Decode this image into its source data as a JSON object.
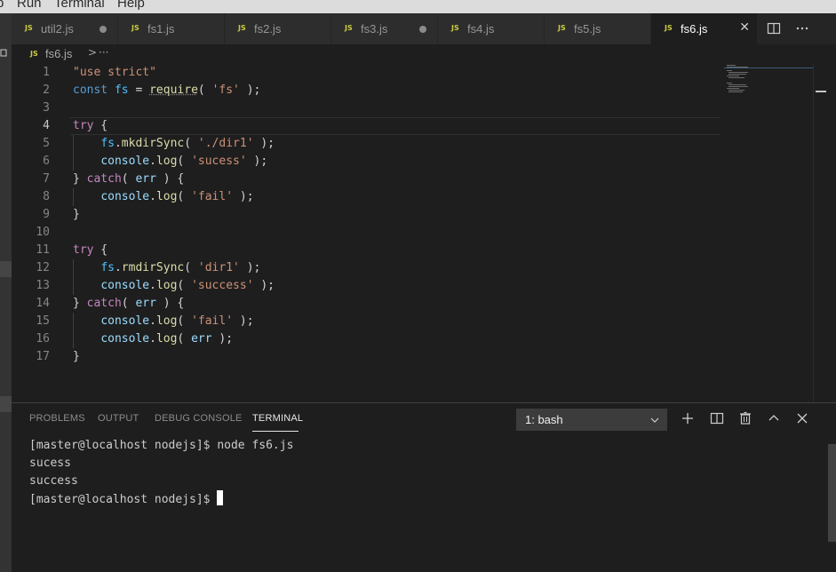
{
  "menubar": {
    "items": [
      "b",
      "Run",
      "Terminal",
      "Help"
    ]
  },
  "tabs": [
    {
      "label": "util2.js",
      "modified": true,
      "active": false
    },
    {
      "label": "fs1.js",
      "modified": false,
      "active": false
    },
    {
      "label": "fs2.js",
      "modified": false,
      "active": false
    },
    {
      "label": "fs3.js",
      "modified": true,
      "active": false
    },
    {
      "label": "fs4.js",
      "modified": false,
      "active": false
    },
    {
      "label": "fs5.js",
      "modified": false,
      "active": false
    },
    {
      "label": "fs6.js",
      "modified": false,
      "active": true
    }
  ],
  "tab_badge": "JS",
  "tab_close_glyph": "✕",
  "editor_actions": [
    "split-editor-icon",
    "more-actions-icon"
  ],
  "breadcrumb": {
    "badge": "JS",
    "file": "fs6.js",
    "separator": ">",
    "more": "···"
  },
  "editor": {
    "current_line": 4,
    "line_numbers": [
      "1",
      "2",
      "3",
      "4",
      "5",
      "6",
      "7",
      "8",
      "9",
      "10",
      "11",
      "12",
      "13",
      "14",
      "15",
      "16",
      "17"
    ]
  },
  "panel": {
    "tabs": [
      "PROBLEMS",
      "OUTPUT",
      "DEBUG CONSOLE",
      "TERMINAL"
    ],
    "active_tab": "TERMINAL",
    "terminal_select": "1: bash",
    "actions": [
      "new-terminal-icon",
      "split-terminal-icon",
      "kill-terminal-icon",
      "maximize-panel-icon",
      "close-panel-icon"
    ],
    "terminal_lines": [
      "[master@localhost nodejs]$ node fs6.js",
      "sucess",
      "success",
      "[master@localhost nodejs]$ "
    ]
  },
  "colors": {
    "keyword": "#c586c0",
    "storage": "#569cd6",
    "string": "#ce9178",
    "variable": "#9cdcfe",
    "constant": "#4fc1ff",
    "function": "#dcdcaa",
    "js_badge": "#cbcb41"
  }
}
